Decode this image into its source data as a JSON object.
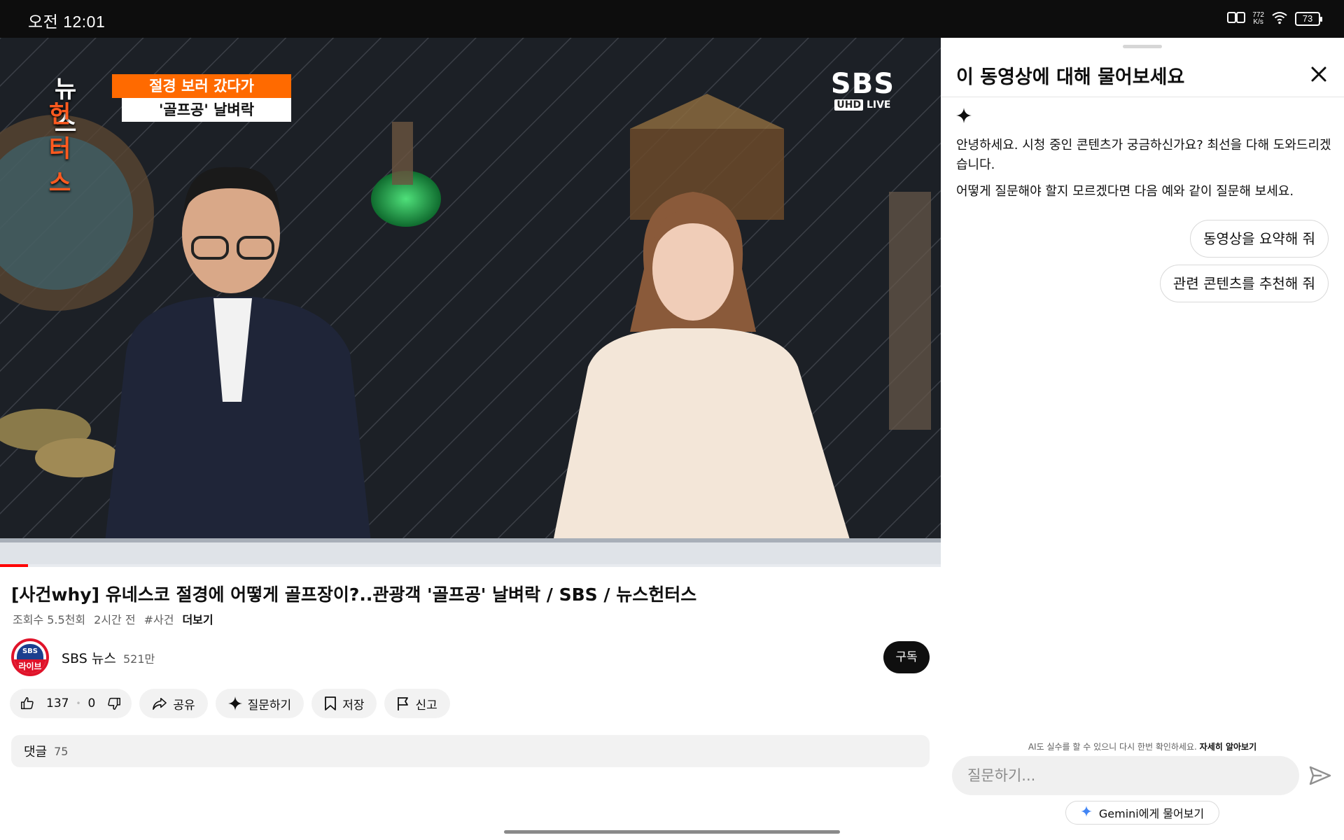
{
  "status_bar": {
    "time": "오전 12:01",
    "network_speed_top": "772",
    "network_speed_unit": "K/s",
    "battery": "73",
    "icons": [
      "reader-mode-icon",
      "wifi-icon",
      "battery-icon"
    ]
  },
  "video": {
    "badge_word_1": "뉴스",
    "badge_word_2": "헌터스",
    "badge_tag": "절경 보러 갔다가",
    "badge_sub": "'골프공' 날벼락",
    "logo_big": "SBS",
    "logo_uhd": "UHD",
    "logo_live": "LIVE",
    "progress": 0.03
  },
  "meta": {
    "title": "[사건why] 유네스코 절경에 어떻게 골프장이?..관광객 '골프공' 날벼락 / SBS / 뉴스헌터스",
    "views": "조회수 5.5천회",
    "time_ago": "2시간 전",
    "hashtag": "#사건",
    "more": "더보기"
  },
  "channel": {
    "avatar_top": "SBS",
    "avatar_bottom": "라이브",
    "name": "SBS 뉴스",
    "subscribers": "521만",
    "subscribe_label": "구독"
  },
  "actions": {
    "likes": "137",
    "dislikes": "0",
    "share": "공유",
    "ask": "질문하기",
    "save": "저장",
    "report": "신고"
  },
  "comments": {
    "label": "댓글",
    "count": "75"
  },
  "panel": {
    "title": "이 동영상에 대해 물어보세요",
    "greeting": "안녕하세요. 시청 중인 콘텐츠가 궁금하신가요? 최선을 다해 도와드리겠습니다.",
    "hint": "어떻게 질문해야 할지 모르겠다면 다음 예와 같이 질문해 보세요.",
    "suggestions": [
      "동영상을 요약해 줘",
      "관련 콘텐츠를 추천해 줘"
    ],
    "disclaimer": "AI도 실수를 할 수 있으니 다시 한번 확인하세요.",
    "learn_more": "자세히 알아보기",
    "input_placeholder": "질문하기...",
    "gemini_label": "Gemini에게 물어보기",
    "accent": "#4285f4"
  }
}
